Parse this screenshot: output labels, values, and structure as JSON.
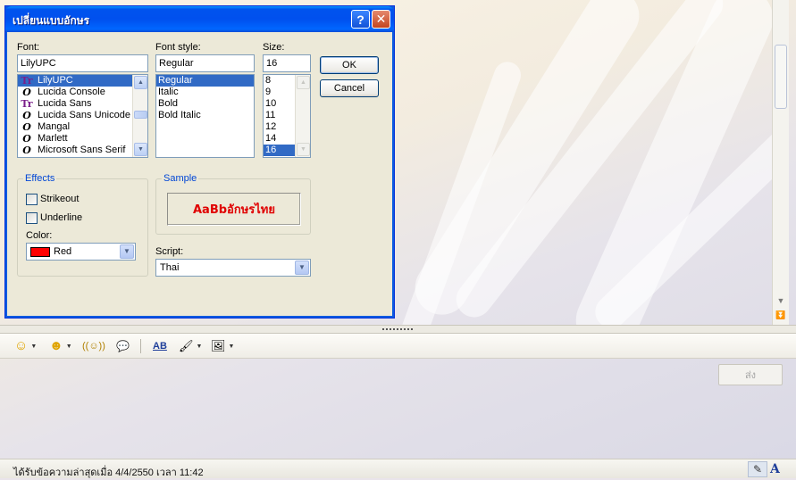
{
  "dialog": {
    "title": "เปลี่ยนแบบอักษร",
    "help_label": "?",
    "close_label": "✕",
    "font": {
      "label": "Font:",
      "value": "LilyUPC",
      "items": [
        {
          "name": "LilyUPC",
          "icon": "truetype-font-icon",
          "glyph": "Tr",
          "selected": true
        },
        {
          "name": "Lucida Console",
          "icon": "opentype-font-icon",
          "glyph": "O"
        },
        {
          "name": "Lucida Sans",
          "icon": "truetype-font-icon",
          "glyph": "Tr"
        },
        {
          "name": "Lucida Sans Unicode",
          "icon": "opentype-font-icon",
          "glyph": "O"
        },
        {
          "name": "Mangal",
          "icon": "opentype-font-icon",
          "glyph": "O"
        },
        {
          "name": "Marlett",
          "icon": "opentype-font-icon",
          "glyph": "O"
        },
        {
          "name": "Microsoft Sans Serif",
          "icon": "opentype-font-icon",
          "glyph": "O"
        }
      ]
    },
    "style": {
      "label": "Font style:",
      "value": "Regular",
      "items": [
        "Regular",
        "Italic",
        "Bold",
        "Bold Italic"
      ]
    },
    "size": {
      "label": "Size:",
      "value": "16",
      "items": [
        "8",
        "9",
        "10",
        "11",
        "12",
        "14",
        "16"
      ]
    },
    "ok_label": "OK",
    "cancel_label": "Cancel",
    "effects": {
      "title": "Effects",
      "strikeout_label": "Strikeout",
      "underline_label": "Underline",
      "color_label": "Color:",
      "color_value": "Red",
      "color_hex": "#ff0000"
    },
    "sample": {
      "title": "Sample",
      "text": "AaBbอักษรไทย",
      "color": "#e00000"
    },
    "script": {
      "label": "Script:",
      "value": "Thai"
    }
  },
  "chat": {
    "toolbar": [
      {
        "name": "emoticon-icon",
        "glyph": "☺",
        "has_menu": true
      },
      {
        "name": "wink-icon",
        "glyph": "☻",
        "has_menu": true
      },
      {
        "name": "nudge-icon",
        "glyph": "((☺))",
        "has_menu": false
      },
      {
        "name": "voice-clip-icon",
        "glyph": "💬",
        "has_menu": false
      },
      {
        "name": "change-font-icon",
        "glyph": "AB",
        "has_menu": false
      },
      {
        "name": "paint-brush-icon",
        "glyph": "🖌",
        "has_menu": true
      },
      {
        "name": "background-icon",
        "glyph": "🖼",
        "has_menu": true
      }
    ],
    "send_label": "ส่ง",
    "status_text": "ได้รับข้อความล่าสุดเมื่อ 4/4/2550 เวลา 11:42",
    "status_pen": "✎",
    "status_font": "A"
  }
}
